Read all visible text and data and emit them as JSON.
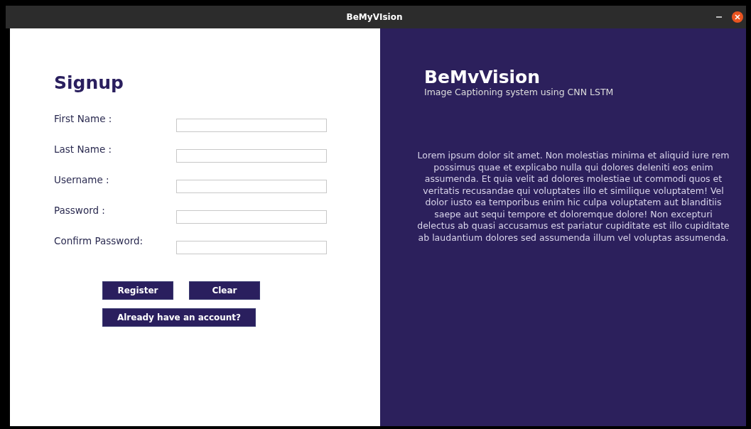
{
  "window": {
    "title": "BeMyVIsion"
  },
  "form": {
    "title": "Signup",
    "fields": [
      {
        "label": "First Name :"
      },
      {
        "label": "Last Name :"
      },
      {
        "label": "Username :"
      },
      {
        "label": "Password :"
      },
      {
        "label": "Confirm Password:"
      }
    ],
    "buttons": [
      "Register",
      "Clear"
    ],
    "link_button": "Already have an account?"
  },
  "info": {
    "title": "BeMvVision",
    "subtitle": "Image Captioning system using CNN LSTM",
    "description": "Lorem ipsum dolor sit amet. Non molestias minima et aliquid iure rem possimus quae et explicabo nulla qui dolores deleniti eos enim assumenda. Et quia velit ad dolores molestiae ut commodi quos et veritatis recusandae qui voluptates illo et similique voluptatem! Vel dolor iusto ea temporibus enim hic culpa voluptatem aut blanditiis saepe aut sequi tempore et doloremque dolore! Non excepturi delectus ab quasi accusamus est pariatur cupiditate est illo cupiditate ab laudantium dolores sed assumenda illum vel voluptas assumenda."
  }
}
